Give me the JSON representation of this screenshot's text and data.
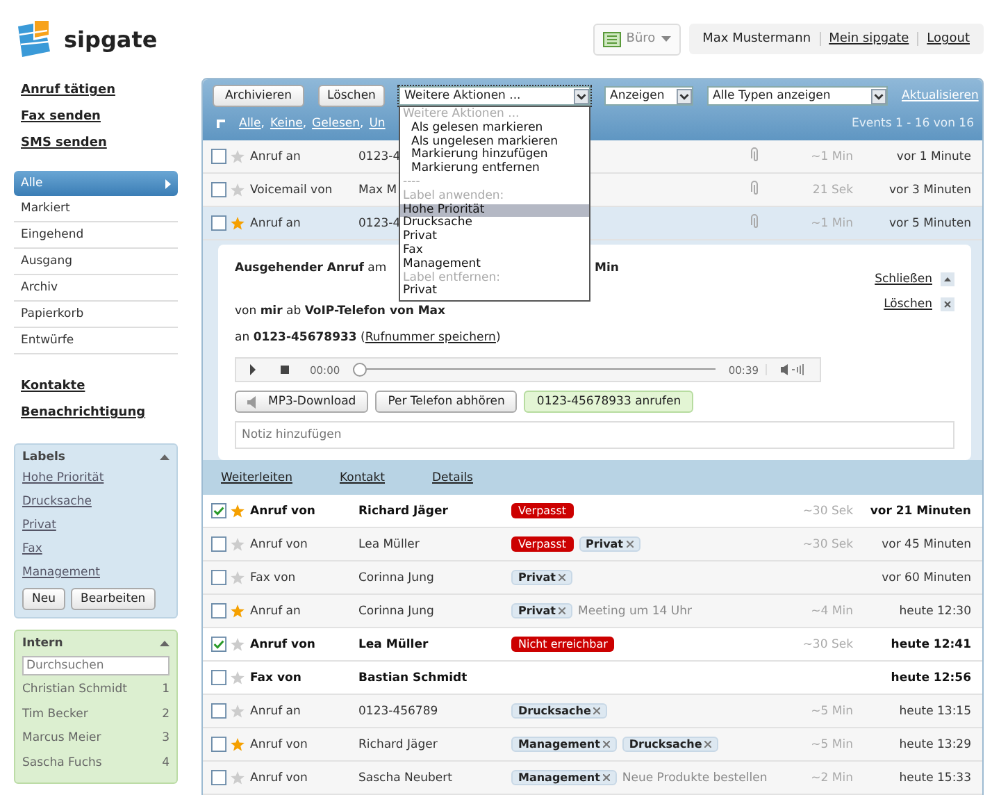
{
  "header": {
    "logo_text": "sipgate",
    "location": "Büro",
    "user_name": "Max Mustermann",
    "links": [
      "Mein sipgate",
      "Logout"
    ]
  },
  "sidebar": {
    "actions": [
      "Anruf tätigen",
      "Fax senden",
      "SMS senden"
    ],
    "folders": [
      {
        "label": "Alle",
        "selected": true
      },
      {
        "label": "Markiert",
        "selected": false
      },
      {
        "label": "Eingehend",
        "selected": false
      },
      {
        "label": "Ausgang",
        "selected": false
      },
      {
        "label": "Archiv",
        "selected": false
      },
      {
        "label": "Papierkorb",
        "selected": false
      },
      {
        "label": "Entwürfe",
        "selected": false
      }
    ],
    "links": [
      "Kontakte",
      "Benachrichtigung"
    ],
    "labels": {
      "title": "Labels",
      "items": [
        "Hohe Priorität",
        "Drucksache",
        "Privat",
        "Fax",
        "Management"
      ],
      "buttons": [
        "Neu",
        "Bearbeiten"
      ]
    },
    "intern": {
      "title": "Intern",
      "search": {
        "placeholder": "Durchsuchen"
      },
      "contacts": [
        {
          "name": "Christian Schmidt",
          "extension": "1"
        },
        {
          "name": "Tim Becker",
          "extension": "2"
        },
        {
          "name": "Marcus Meier",
          "extension": "3"
        },
        {
          "name": "Sascha Fuchs",
          "extension": "4"
        }
      ]
    }
  },
  "toolbar": {
    "buttons": [
      "Archivieren",
      "Löschen"
    ],
    "actions_select": "Weitere Aktionen ...",
    "view_select": "Anzeigen",
    "type_select": "Alle Typen anzeigen",
    "refresh": "Aktualisieren",
    "filters": [
      "Alle",
      "Keine",
      "Gelesen",
      "Un"
    ],
    "filter_separator": ",",
    "count": "Events 1 - 16 von 16"
  },
  "actions_menu": [
    {
      "label": "Weitere Aktionen ...",
      "kind": "heading",
      "selected": false
    },
    {
      "label": "Als gelesen markieren",
      "kind": "action",
      "selected": false
    },
    {
      "label": "Als ungelesen markieren",
      "kind": "action",
      "selected": false
    },
    {
      "label": "Markierung hinzufügen",
      "kind": "action",
      "selected": false
    },
    {
      "label": "Markierung entfernen",
      "kind": "action",
      "selected": false
    },
    {
      "label": "----",
      "kind": "heading",
      "selected": false
    },
    {
      "label": "Label anwenden:",
      "kind": "heading",
      "selected": false
    },
    {
      "label": "Hohe Priorität",
      "kind": "label",
      "selected": true
    },
    {
      "label": "Drucksache",
      "kind": "label",
      "selected": false
    },
    {
      "label": "Privat",
      "kind": "label",
      "selected": false
    },
    {
      "label": "Fax",
      "kind": "label",
      "selected": false
    },
    {
      "label": "Management",
      "kind": "label",
      "selected": false
    },
    {
      "label": "Label entfernen:",
      "kind": "heading",
      "selected": false
    },
    {
      "label": "Privat",
      "kind": "label",
      "selected": false
    }
  ],
  "rows": [
    {
      "type": "Anruf an",
      "name": "0123-4",
      "checked": false,
      "starred": false,
      "unread": false,
      "expanded": false,
      "attachment": true,
      "duration": "~1 Min",
      "time": "vor 1 Minute",
      "tags": []
    },
    {
      "type": "Voicemail von",
      "name": "Max M",
      "checked": false,
      "starred": false,
      "unread": false,
      "expanded": false,
      "attachment": true,
      "duration": "21 Sek",
      "time": "vor 3 Minuten",
      "tags": []
    },
    {
      "type": "Anruf an",
      "name": "0123-4",
      "checked": false,
      "starred": true,
      "unread": false,
      "expanded": true,
      "attachment": true,
      "duration": "~1 Min",
      "time": "vor 5 Minuten",
      "tags": []
    },
    {
      "type": "Anruf von",
      "name": "Richard Jäger",
      "checked": true,
      "starred": true,
      "unread": true,
      "expanded": false,
      "attachment": false,
      "duration": "~30 Sek",
      "time": "vor 21 Minuten",
      "tags": [
        {
          "label": "Verpasst",
          "kind": "status"
        }
      ]
    },
    {
      "type": "Anruf von",
      "name": "Lea Müller",
      "checked": false,
      "starred": false,
      "unread": false,
      "expanded": false,
      "attachment": false,
      "duration": "~30 Sek",
      "time": "vor 45 Minuten",
      "tags": [
        {
          "label": "Verpasst",
          "kind": "status"
        },
        {
          "label": "Privat",
          "kind": "label"
        }
      ]
    },
    {
      "type": "Fax von",
      "name": "Corinna Jung",
      "checked": false,
      "starred": false,
      "unread": false,
      "expanded": false,
      "attachment": false,
      "time": "vor 60 Minuten",
      "tags": [
        {
          "label": "Privat",
          "kind": "label"
        }
      ]
    },
    {
      "type": "Anruf an",
      "name": "Corinna Jung",
      "checked": false,
      "starred": true,
      "unread": false,
      "expanded": false,
      "attachment": false,
      "note": "Meeting um 14 Uhr",
      "duration": "~4 Min",
      "time": "heute 12:30",
      "tags": [
        {
          "label": "Privat",
          "kind": "label"
        }
      ]
    },
    {
      "type": "Anruf von",
      "name": "Lea Müller",
      "checked": true,
      "starred": false,
      "unread": true,
      "expanded": false,
      "attachment": false,
      "duration": "~30 Sek",
      "time": "heute 12:41",
      "tags": [
        {
          "label": "Nicht erreichbar",
          "kind": "status"
        }
      ]
    },
    {
      "type": "Fax von",
      "name": "Bastian Schmidt",
      "checked": false,
      "starred": false,
      "unread": true,
      "expanded": false,
      "attachment": false,
      "time": "heute 12:56",
      "tags": []
    },
    {
      "type": "Anruf an",
      "name": "0123-456789",
      "checked": false,
      "starred": false,
      "unread": false,
      "expanded": false,
      "attachment": false,
      "duration": "~5 Min",
      "time": "heute 13:15",
      "tags": [
        {
          "label": "Drucksache",
          "kind": "label"
        }
      ]
    },
    {
      "type": "Anruf von",
      "name": "Richard Jäger",
      "checked": false,
      "starred": true,
      "unread": false,
      "expanded": false,
      "attachment": false,
      "duration": "~5 Min",
      "time": "heute 13:29",
      "tags": [
        {
          "label": "Management",
          "kind": "label"
        },
        {
          "label": "Drucksache",
          "kind": "label"
        }
      ]
    },
    {
      "type": "Anruf von",
      "name": "Sascha Neubert",
      "checked": false,
      "starred": false,
      "unread": false,
      "expanded": false,
      "attachment": false,
      "note": "Neue Produkte bestellen",
      "duration": "~2 Min",
      "time": "heute 15:33",
      "tags": [
        {
          "label": "Management",
          "kind": "label"
        }
      ]
    }
  ],
  "detail": {
    "title": "**Ausgehender Anruf** am",
    "title_end": "Min",
    "from": "von **mir** ab **VoIP-Telefon von Max**",
    "to": "an **0123-45678933** (",
    "save_link": "Rufnummer speichern",
    "to_end": ")",
    "close": "Schließen",
    "delete": "Löschen",
    "player": {
      "position": "00:00",
      "length": "00:39",
      "level": 0
    },
    "buttons": [
      {
        "label": "MP3-Download",
        "kind": "download"
      },
      {
        "label": "Per Telefon abhören",
        "kind": "plain"
      },
      {
        "label": "0123-45678933 anrufen",
        "kind": "call"
      }
    ],
    "note": {
      "placeholder": "Notiz hinzufügen"
    },
    "links": [
      "Weiterleiten",
      "Kontakt",
      "Details"
    ]
  }
}
